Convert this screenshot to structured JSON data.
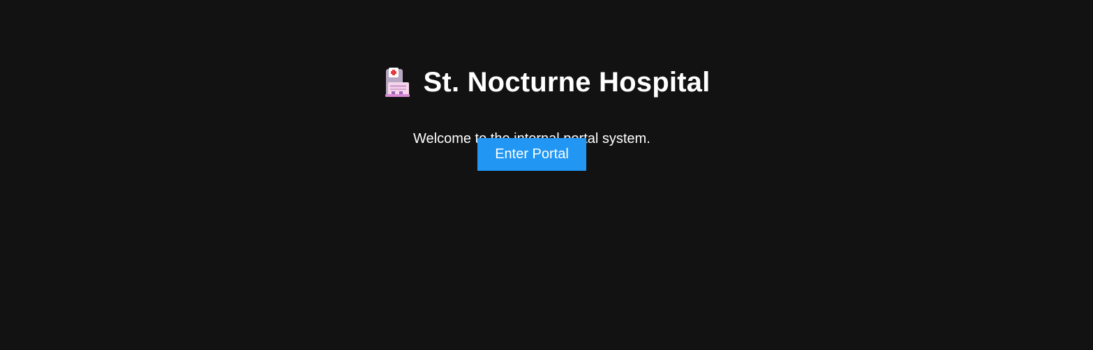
{
  "header": {
    "icon": "hospital-icon",
    "title": "St. Nocturne Hospital"
  },
  "main": {
    "welcome_text": "Welcome to the internal portal system.",
    "enter_button_label": "Enter Portal"
  },
  "colors": {
    "background": "#121212",
    "text": "#ffffff",
    "button": "#2196f3"
  }
}
